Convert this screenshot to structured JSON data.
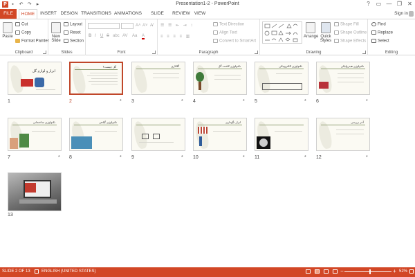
{
  "window": {
    "title": "Presentation1-2 - PowerPoint",
    "app_icon": "P",
    "quick_access": [
      "save-icon",
      "undo-icon",
      "redo-icon",
      "present-icon"
    ],
    "controls": [
      "?",
      "▭",
      "—",
      "❐",
      "✕"
    ],
    "sign_in": "Sign in"
  },
  "tabs": [
    "FILE",
    "HOME",
    "INSERT",
    "DESIGN",
    "TRANSITIONS",
    "ANIMATIONS",
    "SLIDE SHOW",
    "REVIEW",
    "VIEW"
  ],
  "ribbon": {
    "clipboard": {
      "label": "Clipboard",
      "paste": "Paste",
      "cut": "Cut",
      "copy": "Copy",
      "format_painter": "Format Painter"
    },
    "slides": {
      "label": "Slides",
      "new_slide": "New Slide",
      "layout": "Layout",
      "reset": "Reset",
      "section": "Section"
    },
    "font": {
      "label": "Font",
      "font_name": "",
      "font_size": "",
      "grow": "A˄",
      "shrink": "A˅",
      "clear": "A̸",
      "bold": "B",
      "italic": "I",
      "underline": "U",
      "strike": "S",
      "shadow": "abc",
      "spacing": "AV",
      "case": "Aa",
      "color": "A"
    },
    "paragraph": {
      "label": "Paragraph",
      "text_direction": "Text Direction",
      "align_text": "Align Text",
      "convert_smartart": "Convert to SmartArt"
    },
    "drawing": {
      "label": "Drawing",
      "arrange": "Arrange",
      "quick_styles": "Quick Styles",
      "shape_fill": "Shape Fill",
      "shape_outline": "Shape Outline",
      "shape_effects": "Shape Effects"
    },
    "editing": {
      "label": "Editing",
      "find": "Find",
      "replace": "Replace",
      "select": "Select"
    }
  },
  "slides": [
    {
      "num": "1",
      "title": "ابزار و لوازم گل",
      "star": ""
    },
    {
      "num": "2",
      "title": "گل چیست؟",
      "star": "*"
    },
    {
      "num": "3",
      "title": "گلکاری",
      "star": "*"
    },
    {
      "num": "4",
      "title": "تکنولوژی کاشت گل",
      "star": "*"
    },
    {
      "num": "5",
      "title": "تکنولوژی الکترونیکی",
      "star": "*"
    },
    {
      "num": "6",
      "title": "تکنولوژی هیدرولیکی",
      "star": "*"
    },
    {
      "num": "7",
      "title": "تکنولوژی ساختمانی",
      "star": "*"
    },
    {
      "num": "8",
      "title": "تکنولوژی گیاهی",
      "star": "*"
    },
    {
      "num": "9",
      "title": "",
      "star": "*"
    },
    {
      "num": "10",
      "title": "ابزار نگهداری",
      "star": "*"
    },
    {
      "num": "11",
      "title": "",
      "star": "*"
    },
    {
      "num": "12",
      "title": "آخر بررسی",
      "star": "*"
    },
    {
      "num": "13",
      "title": "",
      "star": ""
    }
  ],
  "status": {
    "slide_info": "SLIDE 2 OF 13",
    "language": "ENGLISH (UNITED STATES)",
    "zoom": "52%",
    "zoom_minus": "−",
    "zoom_plus": "+"
  },
  "colors": {
    "accent": "#d24726",
    "selected_border": "#c0472a"
  }
}
